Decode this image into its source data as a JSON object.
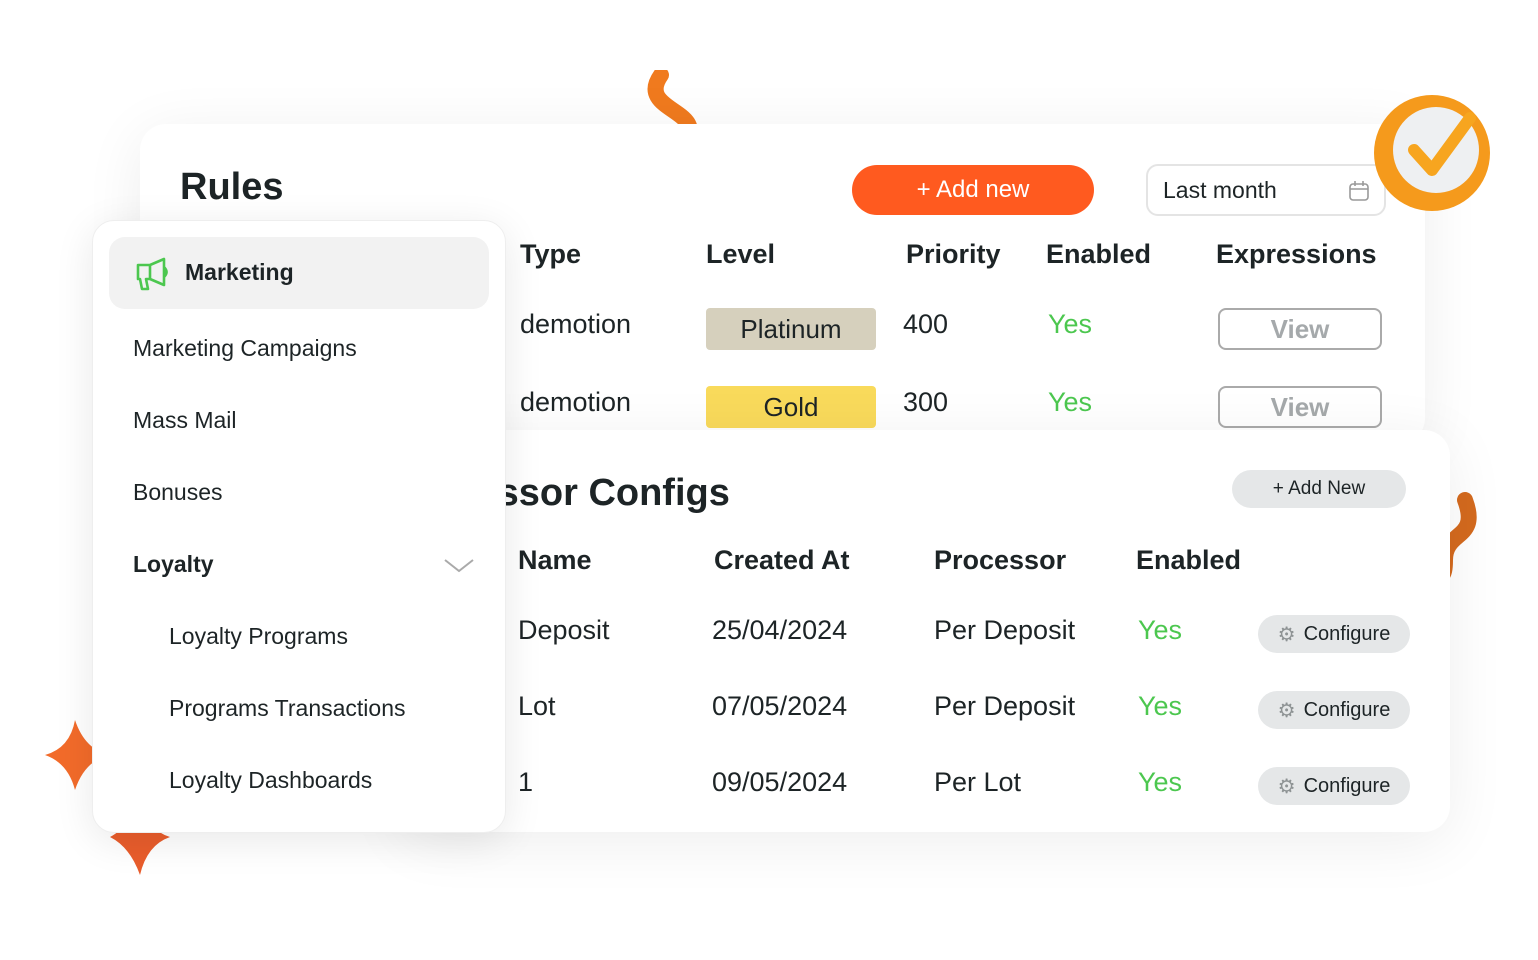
{
  "rules": {
    "title": "Rules",
    "add_label": "+ Add new",
    "date_filter": "Last month",
    "columns": [
      "Type",
      "Level",
      "Priority",
      "Enabled",
      "Expressions"
    ],
    "rows": [
      {
        "type": "demotion",
        "level": "Platinum",
        "level_color": "#d6d0bd",
        "priority": "400",
        "enabled": "Yes",
        "action": "View"
      },
      {
        "type": "demotion",
        "level": "Gold",
        "level_color": "#f9da5b",
        "priority": "300",
        "enabled": "Yes",
        "action": "View"
      }
    ]
  },
  "processor": {
    "title": "Processor Configs",
    "add_label": "+ Add New",
    "columns": [
      "Name",
      "Created At",
      "Processor",
      "Enabled"
    ],
    "rows": [
      {
        "name": "Deposit",
        "created": "25/04/2024",
        "processor": "Per Deposit",
        "enabled": "Yes",
        "action": "Configure"
      },
      {
        "name": "Lot",
        "created": "07/05/2024",
        "processor": "Per Deposit",
        "enabled": "Yes",
        "action": "Configure"
      },
      {
        "name": "1",
        "created": "09/05/2024",
        "processor": "Per Lot",
        "enabled": "Yes",
        "action": "Configure"
      }
    ]
  },
  "sidebar": {
    "active": "Marketing",
    "items": [
      "Marketing Campaigns",
      "Mass Mail",
      "Bonuses"
    ],
    "group": "Loyalty",
    "sub_items": [
      "Loyalty Programs",
      "Programs Transactions",
      "Loyalty Dashboards"
    ]
  },
  "colors": {
    "accent": "#ff5a1f",
    "success": "#4cc74f",
    "icon_green": "#4cc74f"
  }
}
